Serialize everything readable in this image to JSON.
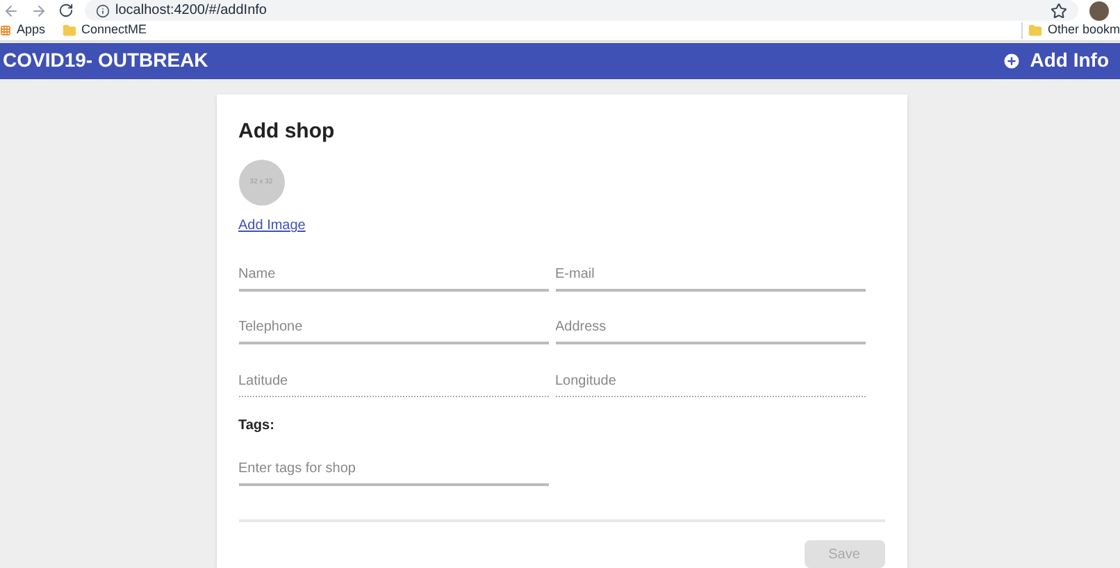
{
  "browser": {
    "url": "localhost:4200/#/addInfo",
    "bookmarks": [
      "Apps",
      "ConnectME"
    ],
    "other_bookmarks": "Other bookm"
  },
  "app_bar": {
    "title": "COVID19- OUTBREAK",
    "action": "Add Info"
  },
  "form": {
    "title": "Add shop",
    "image_placeholder": "32 x 32",
    "add_image": "Add Image",
    "fields": [
      {
        "placeholder": "Name",
        "disabled": false
      },
      {
        "placeholder": "E-mail",
        "disabled": false
      },
      {
        "placeholder": "Telephone",
        "disabled": false
      },
      {
        "placeholder": "Address",
        "disabled": false
      },
      {
        "placeholder": "Latitude",
        "disabled": true
      },
      {
        "placeholder": "Longitude",
        "disabled": true
      }
    ],
    "tags_label": "Tags:",
    "tags_placeholder": "Enter tags for shop",
    "save": {
      "label": "Save",
      "disabled": true
    }
  }
}
